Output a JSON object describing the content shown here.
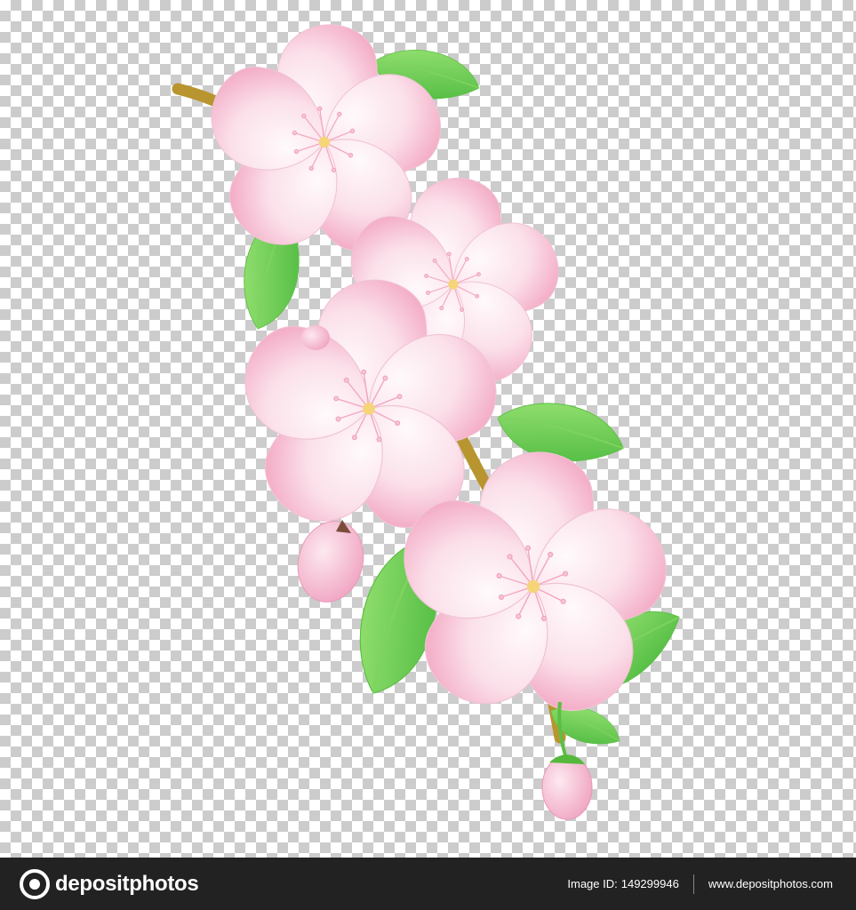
{
  "image": {
    "subject": "Pink cherry blossom branch with green leaves and buds",
    "background_pattern": "transparency-checkerboard"
  },
  "footer": {
    "brand": "depositphotos",
    "image_id_label": "Image ID:",
    "image_id": "149299946",
    "site_url": "www.depositphotos.com"
  },
  "colors": {
    "petal_light": "#fdf2f6",
    "petal_pink": "#f5b8cf",
    "leaf_light": "#8ee06a",
    "leaf_dark": "#3fb236",
    "branch": "#b8952f",
    "footer_bg": "#222222"
  }
}
